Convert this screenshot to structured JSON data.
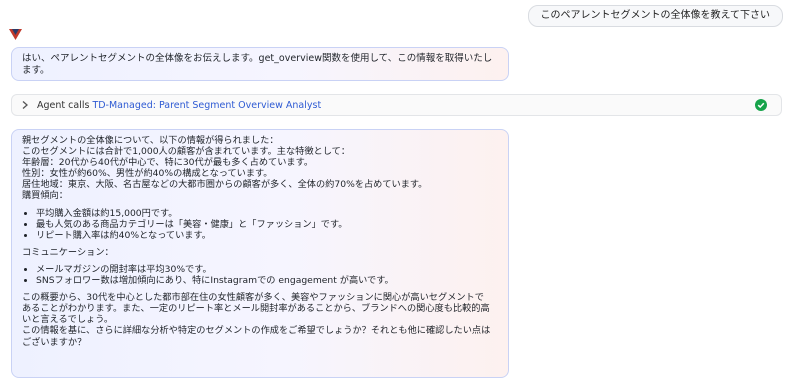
{
  "user_message": "このペアレントセグメントの全体像を教えて下さい",
  "agent_intro": "はい、ペアレントセグメントの全体像をお伝えします。get_overview関数を使用して、この情報を取得いたします。",
  "tool_call": {
    "prefix": "Agent calls ",
    "name": "TD-Managed: Parent Segment Overview Analyst",
    "status": "success"
  },
  "response": {
    "summary_lines": [
      "親セグメントの全体像について、以下の情報が得られました：",
      "このセグメントには合計で1,000人の顧客が含まれています。主な特徴として：",
      "年齢層：20代から40代が中心で、特に30代が最も多く占めています。",
      "性別：女性が約60%、男性が約40%の構成となっています。",
      "居住地域：東京、大阪、名古屋などの大都市圏からの顧客が多く、全体の約70%を占めています。",
      "購買傾向："
    ],
    "purchase_items": [
      "平均購入金額は約15,000円です。",
      "最も人気のある商品カテゴリーは「美容・健康」と「ファッション」です。",
      "リピート購入率は約40%となっています。"
    ],
    "communication_heading": "コミュニケーション：",
    "communication_items": [
      "メールマガジンの開封率は平均30%です。",
      "SNSフォロワー数は増加傾向にあり、特にInstagramでの engagement が高いです。"
    ],
    "closing_lines": [
      "この概要から、30代を中心とした都市部在住の女性顧客が多く、美容やファッションに関心が高いセグメントで",
      "あることがわかります。また、一定のリピート率とメール開封率があることから、ブランドへの関心度も比較的高",
      "いと言えるでしょう。",
      "この情報を基に、さらに詳細な分析や特定のセグメントの作成をご希望でしょうか？それとも他に確認したい点は",
      "ございますか？"
    ]
  },
  "colors": {
    "accent_blue": "#2f5bd3",
    "success_green": "#16a34a",
    "avatar_red": "#c0392b",
    "avatar_navy": "#2b3a67"
  }
}
